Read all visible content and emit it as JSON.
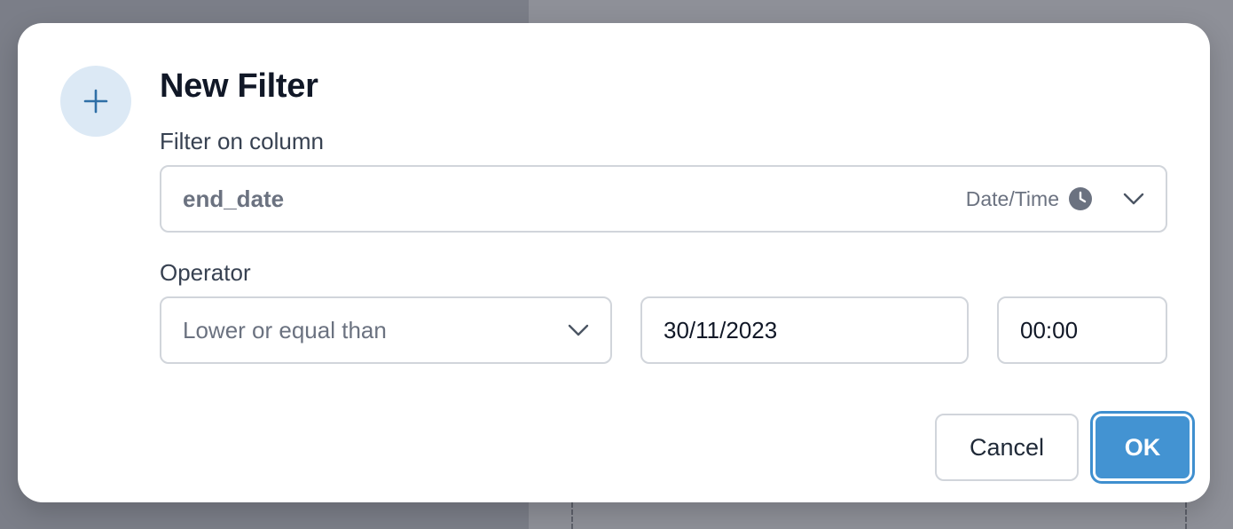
{
  "dialog": {
    "title": "New Filter",
    "header_icon": "plus-icon",
    "column_label": "Filter on column",
    "column_value": "end_date",
    "column_type": "Date/Time",
    "column_type_icon": "clock-icon",
    "operator_label": "Operator",
    "operator_value": "Lower or equal than",
    "date_value": "30/11/2023",
    "time_value": "00:00",
    "cancel_label": "Cancel",
    "ok_label": "OK"
  },
  "colors": {
    "accent": "#4393d2",
    "icon_bg": "#dce9f5",
    "icon_fg": "#2f6fa6"
  }
}
